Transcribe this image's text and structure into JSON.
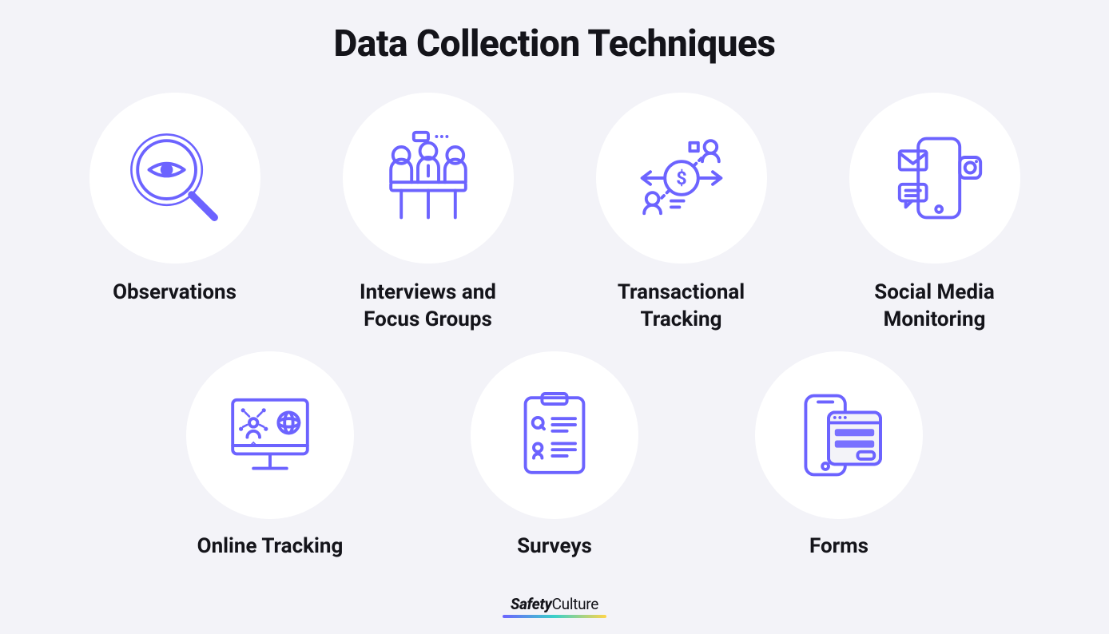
{
  "title": "Data Collection Techniques",
  "items_row1": [
    {
      "label": "Observations",
      "icon": "observations"
    },
    {
      "label": "Interviews and\nFocus Groups",
      "icon": "focus-groups"
    },
    {
      "label": "Transactional\nTracking",
      "icon": "transactional"
    },
    {
      "label": "Social Media\nMonitoring",
      "icon": "social-media"
    }
  ],
  "items_row2": [
    {
      "label": "Online Tracking",
      "icon": "online-tracking"
    },
    {
      "label": "Surveys",
      "icon": "surveys"
    },
    {
      "label": "Forms",
      "icon": "forms"
    }
  ],
  "brand": {
    "part1": "Safety",
    "part2": "Culture"
  },
  "colors": {
    "accent": "#6c63ff",
    "bg": "#f3f3f8",
    "circle": "#ffffff"
  }
}
